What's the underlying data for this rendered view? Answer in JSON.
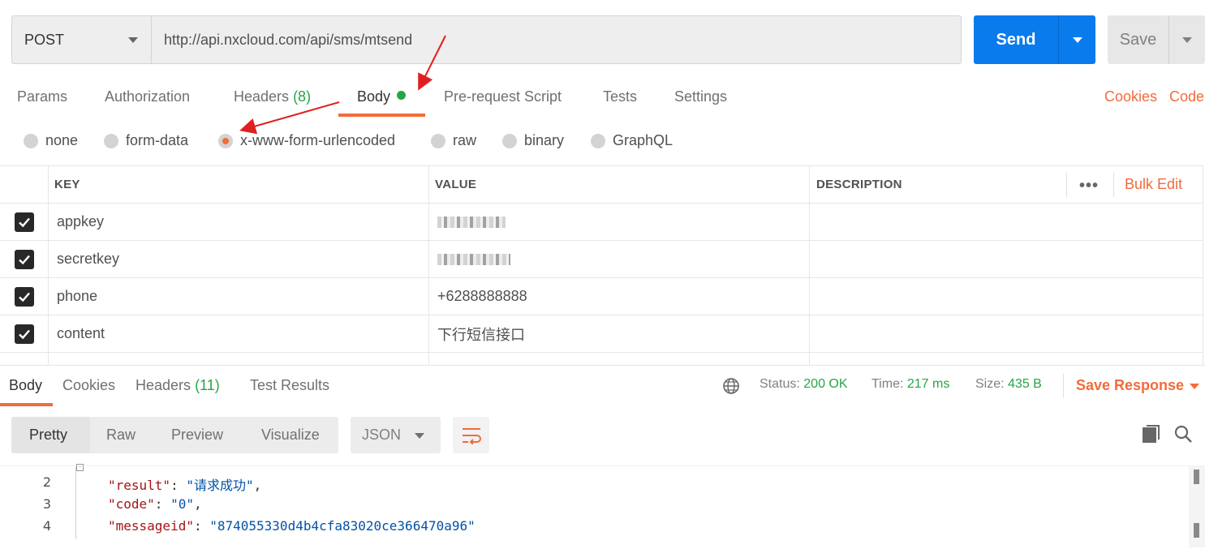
{
  "request": {
    "method": "POST",
    "url": "http://api.nxcloud.com/api/sms/mtsend",
    "send_label": "Send",
    "save_label": "Save"
  },
  "tabs": [
    {
      "label": "Params"
    },
    {
      "label": "Authorization"
    },
    {
      "label": "Headers",
      "count": "(8)"
    },
    {
      "label": "Body"
    },
    {
      "label": "Pre-request Script"
    },
    {
      "label": "Tests"
    },
    {
      "label": "Settings"
    }
  ],
  "links": {
    "cookies": "Cookies",
    "code": "Code"
  },
  "body_types": [
    {
      "label": "none"
    },
    {
      "label": "form-data"
    },
    {
      "label": "x-www-form-urlencoded"
    },
    {
      "label": "raw"
    },
    {
      "label": "binary"
    },
    {
      "label": "GraphQL"
    }
  ],
  "selected_body_type": "x-www-form-urlencoded",
  "table": {
    "headers": {
      "key": "KEY",
      "value": "VALUE",
      "description": "DESCRIPTION"
    },
    "more": "•••",
    "bulk_edit": "Bulk Edit",
    "rows": [
      {
        "checked": true,
        "key": "appkey",
        "value": "",
        "value_redacted": true
      },
      {
        "checked": true,
        "key": "secretkey",
        "value": "",
        "value_redacted": true
      },
      {
        "checked": true,
        "key": "phone",
        "value": "+6288888888"
      },
      {
        "checked": true,
        "key": "content",
        "value": "下行短信接口"
      }
    ]
  },
  "response": {
    "tabs": [
      {
        "label": "Body"
      },
      {
        "label": "Cookies"
      },
      {
        "label": "Headers",
        "count": "(11)"
      },
      {
        "label": "Test Results"
      }
    ],
    "status_label": "Status:",
    "status_value": "200 OK",
    "time_label": "Time:",
    "time_value": "217 ms",
    "size_label": "Size:",
    "size_value": "435 B",
    "save_response": "Save Response",
    "views": [
      "Pretty",
      "Raw",
      "Preview",
      "Visualize"
    ],
    "format": "JSON",
    "code_lines": [
      {
        "n": "2",
        "key": "\"result\"",
        "val": "\"请求成功\"",
        "trail": ","
      },
      {
        "n": "3",
        "key": "\"code\"",
        "val": "\"0\"",
        "trail": ","
      },
      {
        "n": "4",
        "key": "\"messageid\"",
        "val": "\"874055330d4b4cfa83020ce366470a96\"",
        "trail": ""
      }
    ]
  },
  "colors": {
    "accent": "#f26b3a",
    "send": "#097bed",
    "success": "#26a644"
  }
}
